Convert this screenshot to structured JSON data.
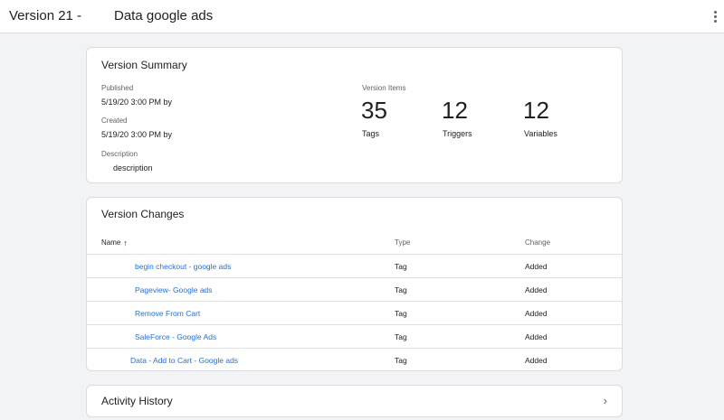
{
  "header": {
    "version_label": "Version 21 -",
    "title": "Data google ads",
    "menu_icon": "more-vert-icon"
  },
  "summary": {
    "title": "Version Summary",
    "published_label": "Published",
    "published_value": "5/19/20 3:00 PM by",
    "created_label": "Created",
    "created_value": "5/19/20 3:00 PM by",
    "description_label": "Description",
    "description_value": "description",
    "items_label": "Version Items",
    "counts": [
      {
        "value": "35",
        "label": "Tags"
      },
      {
        "value": "12",
        "label": "Triggers"
      },
      {
        "value": "12",
        "label": "Variables"
      }
    ]
  },
  "changes": {
    "title": "Version Changes",
    "columns": {
      "name": "Name",
      "type": "Type",
      "change": "Change"
    },
    "sort_icon": "arrow-upward-icon",
    "rows": [
      {
        "name": "begin checkout - google ads",
        "type": "Tag",
        "change": "Added"
      },
      {
        "name": "Pageview- Google ads",
        "type": "Tag",
        "change": "Added"
      },
      {
        "name": "Remove From Cart",
        "type": "Tag",
        "change": "Added"
      },
      {
        "name": "SaleForce - Google Ads",
        "type": "Tag",
        "change": "Added"
      },
      {
        "name": "Data - Add to Cart - Google ads",
        "type": "Tag",
        "change": "Added"
      }
    ]
  },
  "history": {
    "title": "Activity History",
    "chevron_icon": "chevron-right-icon"
  }
}
